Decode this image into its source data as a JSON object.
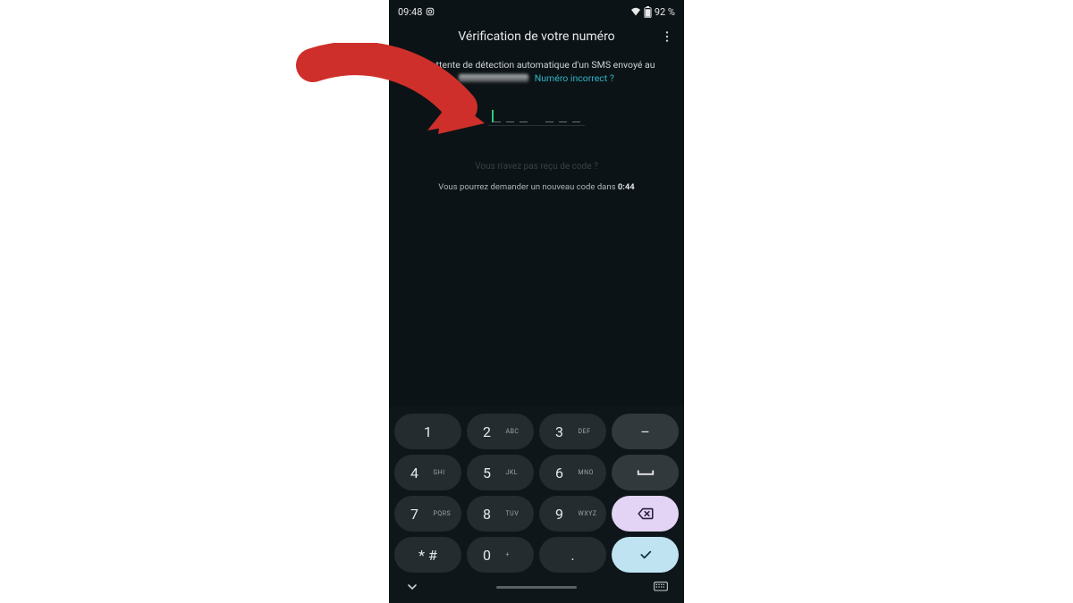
{
  "statusbar": {
    "time": "09:48",
    "battery_pct": "92 %"
  },
  "header": {
    "title": "Vérification de votre numéro"
  },
  "main": {
    "waiting_text": "En attente de détection automatique d'un SMS envoyé au",
    "wrong_number": "Numéro incorrect ?",
    "no_code_text": "Vous n'avez pas reçu de code ?",
    "countdown_prefix": "Vous pourrez demander un nouveau code dans ",
    "countdown_time": "0:44"
  },
  "keypad": {
    "keys": [
      [
        {
          "num": "1",
          "sub": ""
        },
        {
          "num": "2",
          "sub": "ABC"
        },
        {
          "num": "3",
          "sub": "DEF"
        },
        {
          "glyph": "–",
          "accent": "dark"
        }
      ],
      [
        {
          "num": "4",
          "sub": "GHI"
        },
        {
          "num": "5",
          "sub": "JKL"
        },
        {
          "num": "6",
          "sub": "MNO"
        },
        {
          "glyph": "⎵",
          "accent": "dark"
        }
      ],
      [
        {
          "num": "7",
          "sub": "PQRS"
        },
        {
          "num": "8",
          "sub": "TUV"
        },
        {
          "num": "9",
          "sub": "WXYZ"
        },
        {
          "icon": "backspace",
          "accent": "purple"
        }
      ],
      [
        {
          "num": "* #",
          "sub": "",
          "simple": true
        },
        {
          "num": "0",
          "sub": "+"
        },
        {
          "num": ".",
          "sub": "",
          "simple": true
        },
        {
          "icon": "check",
          "accent": "blue"
        }
      ]
    ]
  }
}
